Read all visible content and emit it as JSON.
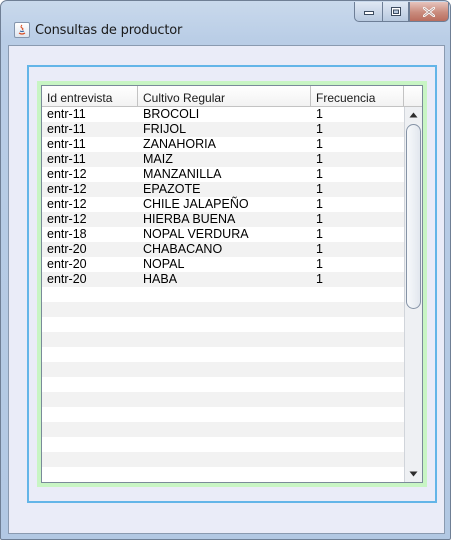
{
  "window": {
    "title": "Consultas de productor"
  },
  "table": {
    "columns": [
      "Id entrevista",
      "Cultivo Regular",
      "Frecuencia"
    ],
    "rows": [
      [
        "entr-11",
        "BROCOLI",
        "1"
      ],
      [
        "entr-11",
        "FRIJOL",
        "1"
      ],
      [
        "entr-11",
        "ZANAHORIA",
        "1"
      ],
      [
        "entr-11",
        "MAIZ",
        "1"
      ],
      [
        "entr-12",
        "MANZANILLA",
        "1"
      ],
      [
        "entr-12",
        "EPAZOTE",
        "1"
      ],
      [
        "entr-12",
        "CHILE JALAPEÑO",
        "1"
      ],
      [
        "entr-12",
        "HIERBA BUENA",
        "1"
      ],
      [
        "entr-18",
        "NOPAL VERDURA",
        "1"
      ],
      [
        "entr-20",
        "CHABACANO",
        "1"
      ],
      [
        "entr-20",
        "NOPAL",
        "1"
      ],
      [
        "entr-20",
        "HABA",
        "1"
      ]
    ]
  },
  "icons": {
    "app": "java-icon",
    "minimize": "minimize-icon",
    "maximize": "maximize-icon",
    "close": "close-icon",
    "scroll_up": "arrow-up-icon",
    "scroll_down": "arrow-down-icon"
  },
  "colors": {
    "frame_border": "#63b5e8",
    "panel_bg": "#c8f5c4",
    "client_bg": "#eaecf8"
  }
}
